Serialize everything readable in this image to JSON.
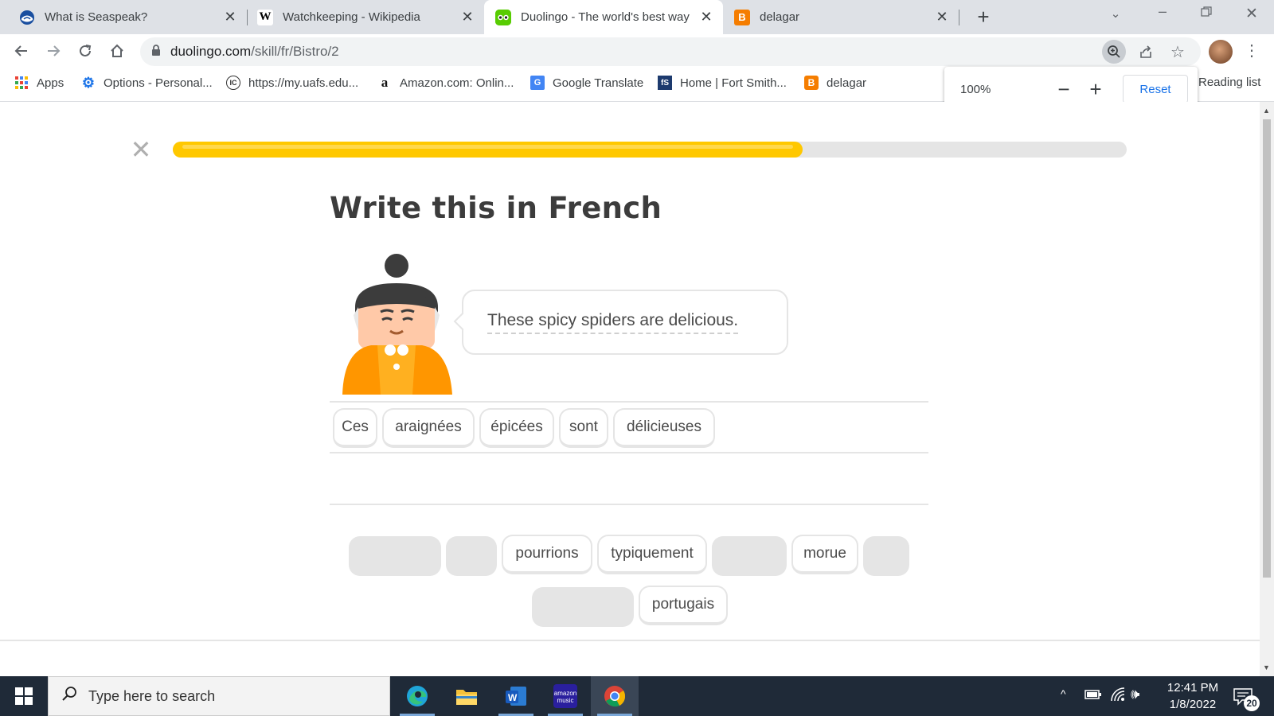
{
  "tabs": [
    {
      "title": "What is Seaspeak?",
      "icon": "noaa-icon",
      "active": false
    },
    {
      "title": "Watchkeeping - Wikipedia",
      "icon": "wikipedia-icon",
      "active": false
    },
    {
      "title": "Duolingo - The world's best way",
      "icon": "duolingo-icon",
      "active": true
    },
    {
      "title": "delagar",
      "icon": "blogger-icon",
      "active": false
    }
  ],
  "toolbar": {
    "url_host": "duolingo.com",
    "url_path": "/skill/fr/Bistro/2"
  },
  "bookmarks": [
    {
      "label": "Apps",
      "icon": "apps-grid-icon"
    },
    {
      "label": "Options - Personal...",
      "icon": "gear-icon"
    },
    {
      "label": "https://my.uafs.edu...",
      "icon": "ic-icon"
    },
    {
      "label": "Amazon.com: Onlin...",
      "icon": "amazon-icon"
    },
    {
      "label": "Google Translate",
      "icon": "google-translate-icon"
    },
    {
      "label": "Home | Fort Smith...",
      "icon": "fs-icon"
    },
    {
      "label": "delagar",
      "icon": "blogger-icon"
    }
  ],
  "reading_list": "Reading list",
  "zoom_popup": {
    "value": "100%",
    "minus": "−",
    "plus": "+",
    "reset": "Reset"
  },
  "lesson": {
    "progress": 0.66,
    "heading": "Write this in French",
    "prompt": "These spicy spiders are delicious.",
    "answer_words": [
      "Ces",
      "araignées",
      "épicées",
      "sont",
      "délicieuses"
    ],
    "bank_row1": [
      "",
      "",
      "pourrions",
      "typiquement",
      "",
      "morue",
      ""
    ],
    "bank_row2": [
      "",
      "portugais"
    ]
  },
  "colors": {
    "progress_fill": "#ffc800",
    "accent_blue": "#1a73e8",
    "taskbar": "#1f2a38"
  },
  "taskbar": {
    "search_placeholder": "Type here to search",
    "apps": [
      "edge-icon",
      "file-explorer-icon",
      "word-icon",
      "amazon-music-icon",
      "chrome-icon"
    ],
    "amazon_music_label": "amazon music",
    "time": "12:41 PM",
    "date": "1/8/2022",
    "notifications": "20"
  }
}
